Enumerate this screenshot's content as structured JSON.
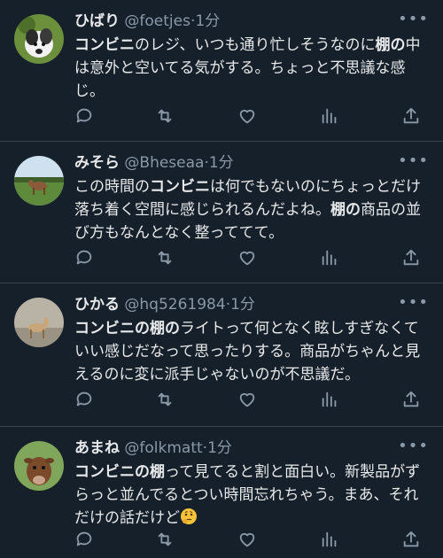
{
  "tweets": [
    {
      "name": "ひばり",
      "handle": "@foetjes",
      "sep": "·",
      "time": "1分",
      "more": "•••",
      "segments": [
        {
          "t": "コンビニ",
          "b": true
        },
        {
          "t": "のレジ、いつも通り忙しそうなのに",
          "b": false
        },
        {
          "t": "棚の",
          "b": true
        },
        {
          "t": "中は意外と空いてる気がする。ちょっと不思議な感じ。",
          "b": false
        }
      ]
    },
    {
      "name": "みそら",
      "handle": "@Bheseaa",
      "sep": "·",
      "time": "1分",
      "more": "•••",
      "segments": [
        {
          "t": "この時間の",
          "b": false
        },
        {
          "t": "コンビニ",
          "b": true
        },
        {
          "t": "は何でもないのにちょっとだけ落ち着く空間に感じられるんだよね。",
          "b": false
        },
        {
          "t": "棚の",
          "b": true
        },
        {
          "t": "商品の",
          "b": false
        },
        {
          "t": "並び方もなんとなく整っててて。",
          "b": false
        }
      ]
    },
    {
      "name": "ひかる",
      "handle": "@hq5261984",
      "sep": "·",
      "time": "1分",
      "more": "•••",
      "segments": [
        {
          "t": "コンビニの",
          "b": true
        },
        {
          "t": "棚の",
          "b": true
        },
        {
          "t": "ライトって何となく眩しすぎなくていい感じだなって思ったりする。商品がちゃんと見えるのに変に派手じゃないのが不思議だ。",
          "b": false
        }
      ]
    },
    {
      "name": "あまね",
      "handle": "@folkmatt",
      "sep": "·",
      "time": "1分",
      "more": "•••",
      "segments": [
        {
          "t": "コンビニの",
          "b": true
        },
        {
          "t": "棚",
          "b": true
        },
        {
          "t": "って見てると割と面白い。新製品がずらっと並んでるとつい時間忘れちゃう。まあ、それだけの",
          "b": false
        },
        {
          "t": "話",
          "b": false
        },
        {
          "t": "だけど",
          "b": false
        }
      ],
      "emoji": "thinking-face-emoji"
    }
  ],
  "icons": {
    "reply": "reply-icon",
    "retweet": "retweet-icon",
    "like": "like-icon",
    "views": "views-icon",
    "share": "share-icon"
  },
  "colors": {
    "background": "#15202b",
    "text": "#e7e9ea",
    "muted": "#8b98a5",
    "divider": "#38444d"
  }
}
